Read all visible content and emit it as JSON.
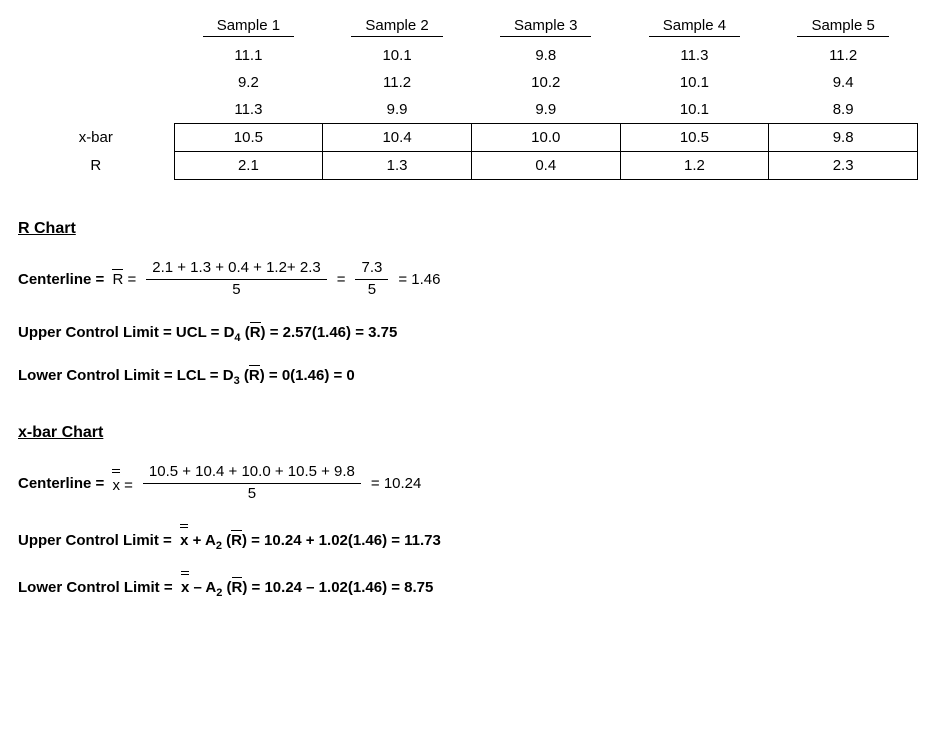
{
  "table": {
    "headers": [
      "Sample 1",
      "Sample 2",
      "Sample 3",
      "Sample 4",
      "Sample 5"
    ],
    "rows": [
      [
        "11.1",
        "10.1",
        "9.8",
        "11.3",
        "11.2"
      ],
      [
        "9.2",
        "11.2",
        "10.2",
        "10.1",
        "9.4"
      ],
      [
        "11.3",
        "9.9",
        "9.9",
        "10.1",
        "8.9"
      ]
    ],
    "xbar_label": "x-bar",
    "xbar": [
      "10.5",
      "10.4",
      "10.0",
      "10.5",
      "9.8"
    ],
    "r_label": "R",
    "r": [
      "2.1",
      "1.3",
      "0.4",
      "1.2",
      "2.3"
    ]
  },
  "r_chart": {
    "title": "R Chart",
    "center_label": "Centerline  = ",
    "rbar_sym": "R",
    "eq1_num": "2.1 + 1.3 + 0.4 + 1.2+ 2.3",
    "eq1_den": "5",
    "eq1_num2": "7.3",
    "eq1_den2": "5",
    "eq1_result": " = 1.46",
    "ucl_label": "Upper Control Limit = UCL = D",
    "ucl_sub": "4",
    "ucl_expr": " = 2.57(1.46) = 3.75",
    "lcl_label": "Lower Control Limit = LCL = D",
    "lcl_sub": "3",
    "lcl_expr": " = 0(1.46) = 0"
  },
  "x_chart": {
    "title": "x-bar Chart",
    "center_label": "Centerline  = ",
    "xsym": "x",
    "eq1_num": "10.5 + 10.4 + 10.0 + 10.5 + 9.8",
    "eq1_den": "5",
    "eq1_result": " = 10.24",
    "ucl_label": "Upper Control Limit = ",
    "a2": "2",
    "rbar_sym": "R",
    "ucl_expr": " = 10.24 + 1.02(1.46) = 11.73",
    "lcl_label": "Lower Control Limit = ",
    "lcl_expr": " = 10.24 – 1.02(1.46) = 8.75",
    "plus": " + A",
    "minus": " – A"
  },
  "misc": {
    "eq": " = ",
    "open": " (",
    "close": ")"
  }
}
